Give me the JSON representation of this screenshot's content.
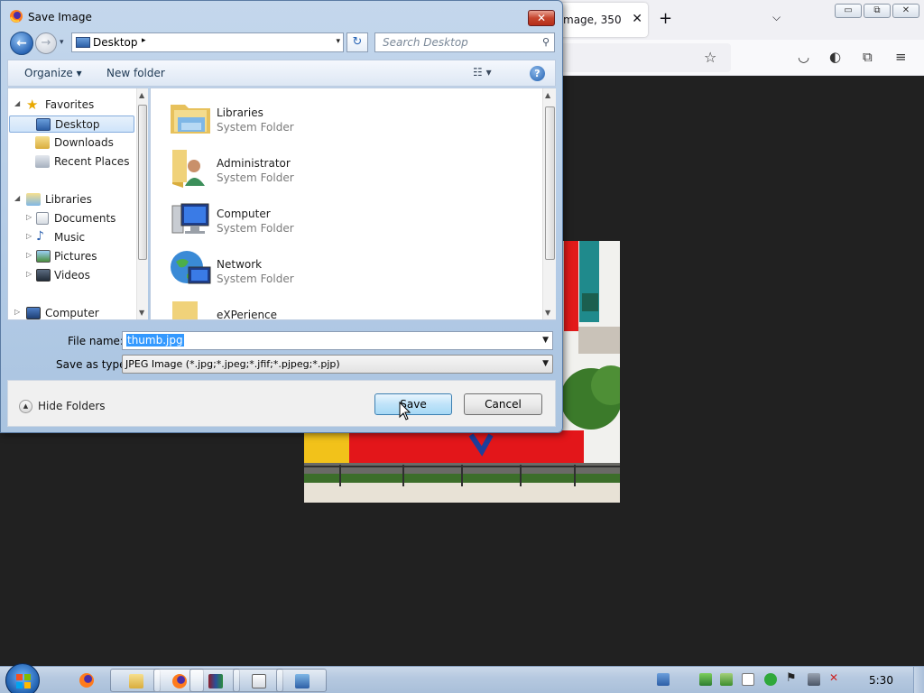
{
  "firefox": {
    "tab_title": "mage, 350",
    "tab_close": "✕",
    "new_tab": "+",
    "list_tabs": "⌵",
    "controls": {
      "minimize": "▭",
      "restore": "⧉",
      "close": "✕"
    },
    "star": "☆",
    "tools": {
      "pocket": "◡",
      "account": "◐",
      "extensions": "⧉",
      "menu": "≡"
    }
  },
  "dialog": {
    "title": "Save Image",
    "close": "✕",
    "nav": {
      "back": "←",
      "forward": "→",
      "dropdown": "▾"
    },
    "address": {
      "text": "Desktop",
      "arrow": "▸",
      "dropdown": "▾"
    },
    "refresh": "↻",
    "search": {
      "placeholder": "Search Desktop",
      "icon": "⚲"
    },
    "toolbar": {
      "organize": "Organize ▾",
      "new_folder": "New folder",
      "views": "☷ ▾",
      "help": "?"
    },
    "nav_pane": {
      "items": [
        {
          "label": "Favorites",
          "icon": "star-icon",
          "expander": "◢"
        },
        {
          "label": "Desktop",
          "icon": "desktop-icon"
        },
        {
          "label": "Downloads",
          "icon": "downloads-icon"
        },
        {
          "label": "Recent Places",
          "icon": "recent-places-icon"
        },
        {
          "label": "Libraries",
          "icon": "libraries-icon",
          "expander": "◢"
        },
        {
          "label": "Documents",
          "icon": "documents-icon",
          "expander": "▷"
        },
        {
          "label": "Music",
          "icon": "music-icon",
          "expander": "▷"
        },
        {
          "label": "Pictures",
          "icon": "pictures-icon",
          "expander": "▷"
        },
        {
          "label": "Videos",
          "icon": "videos-icon",
          "expander": "▷"
        },
        {
          "label": "Computer",
          "icon": "computer-icon",
          "expander": "▷"
        }
      ],
      "scroll_up": "▲",
      "scroll_down": "▼"
    },
    "files": [
      {
        "name": "Libraries",
        "type": "System Folder",
        "icon": "libraries-folder-icon"
      },
      {
        "name": "Administrator",
        "type": "System Folder",
        "icon": "user-folder-icon"
      },
      {
        "name": "Computer",
        "type": "System Folder",
        "icon": "computer-icon"
      },
      {
        "name": "Network",
        "type": "System Folder",
        "icon": "network-icon"
      },
      {
        "name": "eXPerience",
        "type": "",
        "icon": "folder-icon"
      }
    ],
    "file_name": {
      "label": "File name:",
      "value": "thumb.jpg",
      "dropdown": "▼"
    },
    "save_as_type": {
      "label": "Save as type:",
      "value": "JPEG Image (*.jpg;*.jpeg;*.jfif;*.pjpeg;*.pjp)",
      "dropdown": "▼"
    },
    "hide_folders": {
      "label": "Hide Folders",
      "icon": "▲"
    },
    "save_label": "Save",
    "cancel_label": "Cancel"
  },
  "taskbar": {
    "time": "5:30",
    "programs": [
      "firefox-icon",
      "explorer-icon",
      "firefox-icon",
      "winrar-icon",
      "notepad-icon",
      "network-tool-icon"
    ]
  },
  "colors": {
    "selection": "#3399ff",
    "accent": "#2a66b6"
  }
}
